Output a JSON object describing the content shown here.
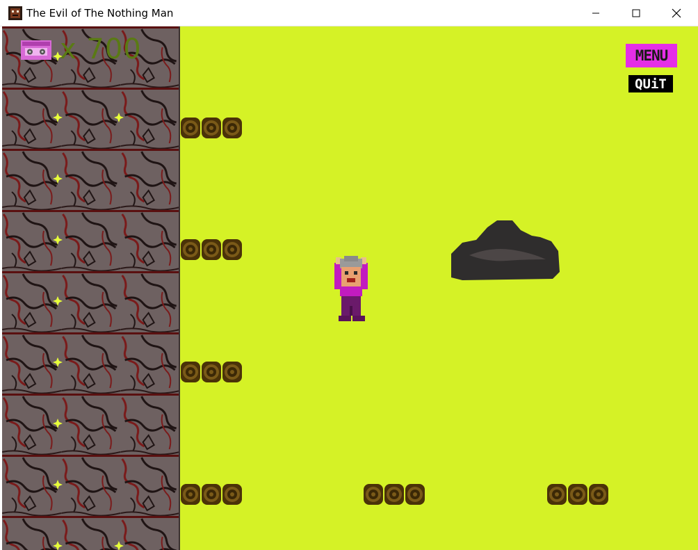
{
  "window": {
    "title": "The Evil of The Nothing Man",
    "icon": "game-app-icon",
    "controls": [
      "minimize-icon",
      "maximize-icon",
      "close-icon"
    ]
  },
  "hud": {
    "collectible_icon": "cassette-tape-icon",
    "tape_label": "TAPE",
    "tape_count": "x 700"
  },
  "buttons": {
    "menu_label": "MENU",
    "quit_label": "QUiT"
  },
  "scene": {
    "background_color": "#d5f226",
    "wall_color": "#6e6161",
    "crack_color": "#1f1414",
    "blood_color": "#7a1a1a",
    "sparkle_color": "#e8ff3a",
    "log_color": "#6b4a10",
    "rock_color": "#2f2d2d",
    "player_color": "#c21bbf"
  }
}
